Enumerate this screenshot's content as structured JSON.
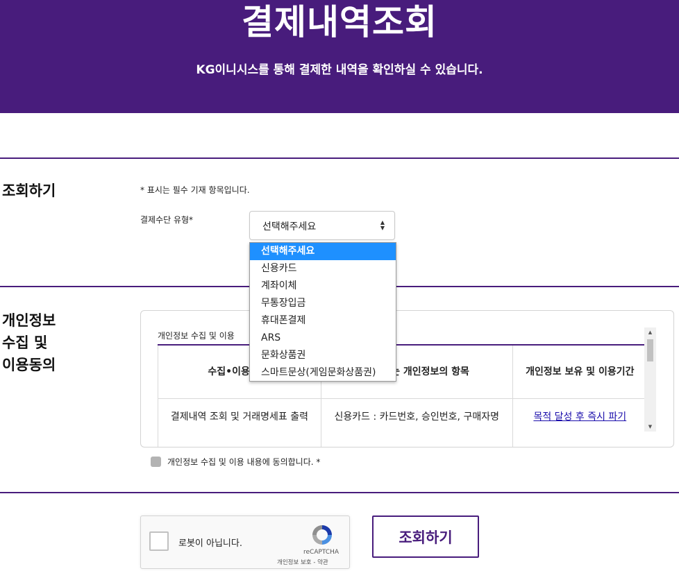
{
  "header": {
    "title": "결제내역조회",
    "subtitle": "KG이니시스를 통해 결제한 내역을 확인하실 수 있습니다."
  },
  "lookup": {
    "section_title": "조회하기",
    "required_note": "* 표시는 필수 기재 항목입니다.",
    "payment_type_label": "결제수단 유형*",
    "selected_value": "선택해주세요",
    "options": [
      "선택해주세요",
      "신용카드",
      "계좌이체",
      "무통장입금",
      "휴대폰결제",
      "ARS",
      "문화상품권",
      "스마트문상(게임문화상품권)"
    ]
  },
  "privacy": {
    "section_title_lines": [
      "개인정보",
      "수집 및",
      "이용동의"
    ],
    "box_caption": "개인정보 수집 및 이용",
    "table_headers": [
      "수집•이용 목적",
      "수집하는 개인정보의 항목",
      "개인정보 보유 및 이용기간"
    ],
    "row1": {
      "purpose": "결제내역 조회 및 거래명세표 출력",
      "items": "신용카드 : 카드번호, 승인번호, 구매자명",
      "period_link": "목적 달성 후 즉시 파기"
    },
    "agree_label": "개인정보 수집 및 이용 내용에 동의합니다. *"
  },
  "captcha": {
    "label": "로봇이 아닙니다.",
    "brand": "reCAPTCHA",
    "links": "개인정보 보호 - 약관"
  },
  "submit_label": "조회하기",
  "colors": {
    "primary": "#481c7c",
    "option_highlight": "#1e90ff"
  }
}
